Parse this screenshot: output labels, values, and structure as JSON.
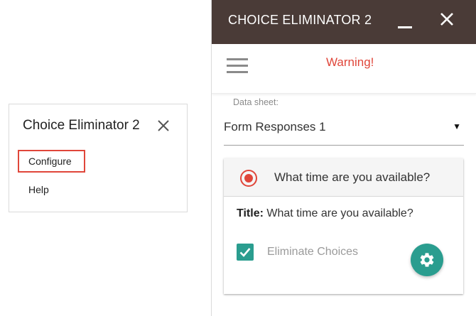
{
  "menu": {
    "title": "Choice Eliminator 2",
    "items": [
      {
        "label": "Configure"
      },
      {
        "label": "Help"
      }
    ]
  },
  "sidebar": {
    "title": "CHOICE ELIMINATOR 2",
    "warning": "Warning!",
    "data_sheet": {
      "label": "Data sheet:",
      "value": "Form Responses 1"
    },
    "question": {
      "header": "What time are you available?",
      "title_label": "Title:",
      "title_value": "What time are you available?",
      "eliminate_label": "Eliminate Choices",
      "eliminate_checked": true
    }
  },
  "colors": {
    "header_bg": "#4a3b37",
    "accent_red": "#e0463a",
    "teal": "#2a9d8f"
  },
  "icons": [
    "close-icon",
    "minimize-icon",
    "hamburger-menu-icon",
    "radio-selected-icon",
    "dropdown-arrow-icon",
    "check-icon",
    "gear-icon"
  ]
}
